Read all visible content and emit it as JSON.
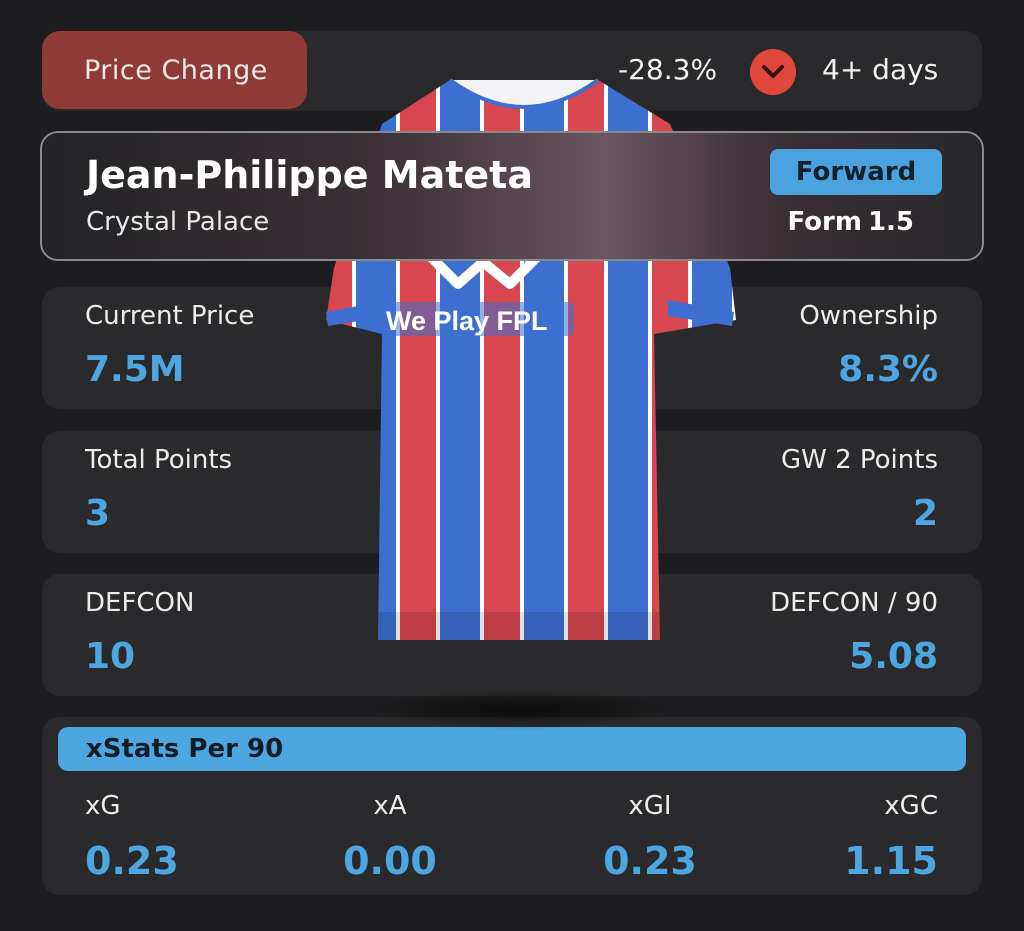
{
  "price_change": {
    "label": "Price Change",
    "value": "-28.3%",
    "icon": "chevron-down-icon",
    "days": "4+ days"
  },
  "player": {
    "name": "Jean-Philippe Mateta",
    "team": "Crystal Palace",
    "position": "Forward",
    "form_label": "Form",
    "form_value": "1.5",
    "jersey_sponsor": "We Play FPL"
  },
  "stats": {
    "current_price": {
      "label": "Current Price",
      "value": "7.5M"
    },
    "ownership": {
      "label": "Ownership",
      "value": "8.3%"
    },
    "total_points": {
      "label": "Total Points",
      "value": "3"
    },
    "gw_points": {
      "label": "GW 2 Points",
      "value": "2"
    },
    "defcon": {
      "label": "DEFCON",
      "value": "10"
    },
    "defcon_per_90": {
      "label": "DEFCON / 90",
      "value": "5.08"
    }
  },
  "xstats": {
    "title": "xStats Per 90",
    "items": [
      {
        "label": "xG",
        "value": "0.23"
      },
      {
        "label": "xA",
        "value": "0.00"
      },
      {
        "label": "xGI",
        "value": "0.23"
      },
      {
        "label": "xGC",
        "value": "1.15"
      }
    ]
  },
  "colors": {
    "accent_blue": "#4ea6e0",
    "price_change_bg": "#8f3a35",
    "down_arrow": "#e0483d",
    "jersey_red": "#d8474f",
    "jersey_blue": "#3d6fd0"
  }
}
